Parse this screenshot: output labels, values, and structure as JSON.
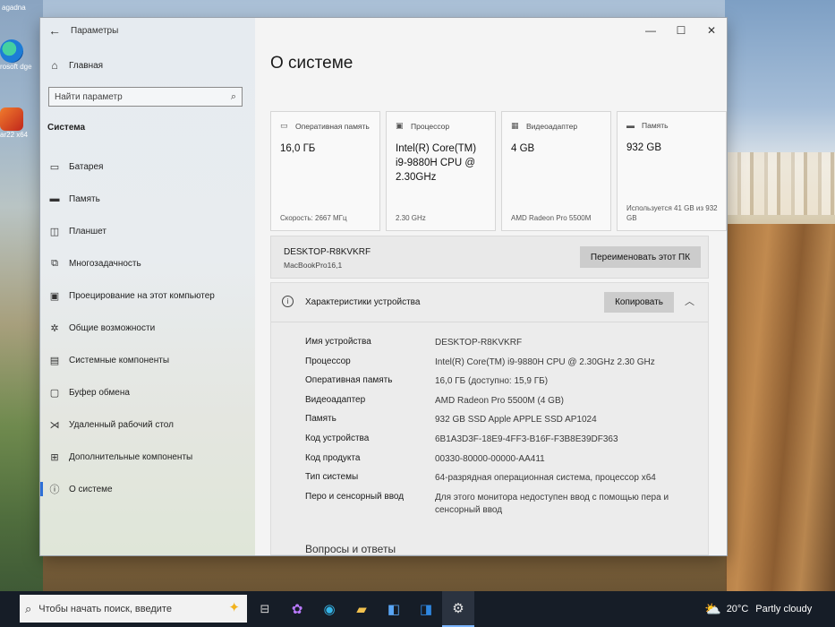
{
  "desktop": {
    "top_label": "agadna",
    "icon_edge_label": "rosoft dge",
    "icon_app_label": "ar22 x64"
  },
  "window": {
    "app_title": "Параметры",
    "controls": {
      "minimize": "—",
      "maximize": "☐",
      "close": "✕"
    }
  },
  "sidebar": {
    "home_label": "Главная",
    "search_placeholder": "Найти параметр",
    "section_title": "Система",
    "items": [
      {
        "label": "Батарея",
        "icon": "battery-icon"
      },
      {
        "label": "Память",
        "icon": "storage-icon"
      },
      {
        "label": "Планшет",
        "icon": "tablet-icon"
      },
      {
        "label": "Многозадачность",
        "icon": "multitasking-icon"
      },
      {
        "label": "Проецирование на этот компьютер",
        "icon": "projecting-icon"
      },
      {
        "label": "Общие возможности",
        "icon": "shared-experiences-icon"
      },
      {
        "label": "Системные компоненты",
        "icon": "system-components-icon"
      },
      {
        "label": "Буфер обмена",
        "icon": "clipboard-icon"
      },
      {
        "label": "Удаленный рабочий стол",
        "icon": "remote-desktop-icon"
      },
      {
        "label": "Дополнительные компоненты",
        "icon": "optional-features-icon"
      },
      {
        "label": "О системе",
        "icon": "info-icon",
        "active": true
      }
    ]
  },
  "main": {
    "page_title": "О системе",
    "cards": [
      {
        "title": "Оперативная память",
        "value": "16,0 ГБ",
        "footer": "Скорость: 2667 МГц",
        "icon": "ram-icon"
      },
      {
        "title": "Процессор",
        "value": "Intel(R) Core(TM) i9-9880H CPU @ 2.30GHz",
        "footer": "2.30 GHz",
        "icon": "cpu-icon"
      },
      {
        "title": "Видеоадаптер",
        "value": "4 GB",
        "footer": "AMD Radeon Pro 5500M",
        "icon": "gpu-icon"
      },
      {
        "title": "Память",
        "value": "932 GB",
        "footer": "Используется 41 GB из 932 GB",
        "icon": "disk-icon"
      }
    ],
    "pc": {
      "name": "DESKTOP-R8KVKRF",
      "model": "MacBookPro16,1",
      "rename_button": "Переименовать этот ПК"
    },
    "specs": {
      "title": "Характеристики устройства",
      "copy_button": "Копировать",
      "rows": [
        {
          "key": "Имя устройства",
          "value": "DESKTOP-R8KVKRF"
        },
        {
          "key": "Процессор",
          "value": "Intel(R) Core(TM) i9-9880H CPU @ 2.30GHz   2.30 GHz"
        },
        {
          "key": "Оперативная память",
          "value": "16,0 ГБ (доступно: 15,9 ГБ)"
        },
        {
          "key": "Видеоадаптер",
          "value": "AMD Radeon Pro 5500M (4 GB)"
        },
        {
          "key": "Память",
          "value": "932 GB SSD Apple APPLE SSD AP1024"
        },
        {
          "key": "Код устройства",
          "value": "6B1A3D3F-18E9-4FF3-B16F-F3B8E39DF363"
        },
        {
          "key": "Код продукта",
          "value": "00330-80000-00000-AA411"
        },
        {
          "key": "Тип системы",
          "value": "64-разрядная операционная система, процессор x64"
        },
        {
          "key": "Перо и сенсорный ввод",
          "value": "Для этого монитора недоступен ввод с помощью пера и сенсорный ввод"
        }
      ]
    },
    "faq_heading": "Вопросы и ответы"
  },
  "taskbar": {
    "search_placeholder": "Чтобы начать поиск, введите",
    "weather_temp": "20°C",
    "weather_desc": "Partly cloudy"
  },
  "colors": {
    "accent": "#2d6fd6",
    "taskbar": "#161d27",
    "button": "#cccccc"
  }
}
